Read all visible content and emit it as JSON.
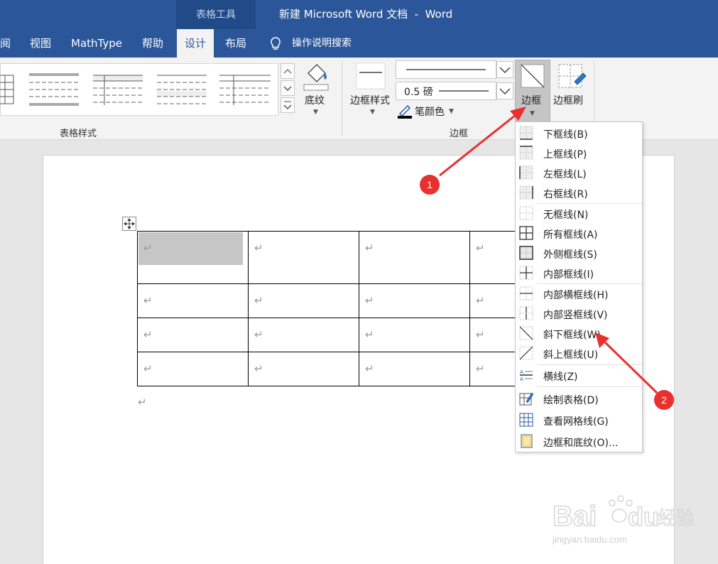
{
  "titlebar": {
    "context_tab": "表格工具",
    "title": "新建 Microsoft Word 文档  -  Word"
  },
  "tabs": {
    "review_partial": "阅",
    "view": "视图",
    "mathtype": "MathType",
    "help": "帮助",
    "design": "设计",
    "layout": "布局",
    "tell_me": "操作说明搜索"
  },
  "ribbon": {
    "table_styles_group": "表格样式",
    "shading": "底纹",
    "border_styles": "边框样式",
    "line_weight": "0.5 磅",
    "pen_color": "笔颜色",
    "borders": "边框",
    "border_painter": "边框刷",
    "borders_group": "边框"
  },
  "document": {
    "table_rows": 4,
    "table_cols": 4,
    "paragraph_mark": "↵",
    "selected_cell": "r0c0"
  },
  "menu": {
    "items": [
      {
        "label": "下框线(B)",
        "icon": "bottom-border-icon"
      },
      {
        "label": "上框线(P)",
        "icon": "top-border-icon"
      },
      {
        "label": "左框线(L)",
        "icon": "left-border-icon"
      },
      {
        "label": "右框线(R)",
        "icon": "right-border-icon"
      },
      {
        "label": "无框线(N)",
        "icon": "no-border-icon"
      },
      {
        "label": "所有框线(A)",
        "icon": "all-borders-icon"
      },
      {
        "label": "外侧框线(S)",
        "icon": "outside-borders-icon"
      },
      {
        "label": "内部框线(I)",
        "icon": "inside-borders-icon"
      },
      {
        "label": "内部横框线(H)",
        "icon": "inside-horizontal-border-icon"
      },
      {
        "label": "内部竖框线(V)",
        "icon": "inside-vertical-border-icon"
      },
      {
        "label": "斜下框线(W)",
        "icon": "diagonal-down-border-icon"
      },
      {
        "label": "斜上框线(U)",
        "icon": "diagonal-up-border-icon"
      },
      {
        "label": "横线(Z)",
        "icon": "horizontal-line-icon"
      },
      {
        "label": "绘制表格(D)",
        "icon": "draw-table-icon"
      },
      {
        "label": "查看网格线(G)",
        "icon": "view-gridlines-icon"
      },
      {
        "label": "边框和底纹(O)...",
        "icon": "borders-shading-icon"
      }
    ]
  },
  "annotations": {
    "badge1": "1",
    "badge2": "2",
    "accent_color": "#e8302f"
  },
  "watermark": {
    "sub": "jingyan.baidu.com"
  },
  "colors": {
    "word_blue": "#2b579a",
    "context_dark": "#214a88",
    "ribbon_bg": "#f3f3f3"
  }
}
